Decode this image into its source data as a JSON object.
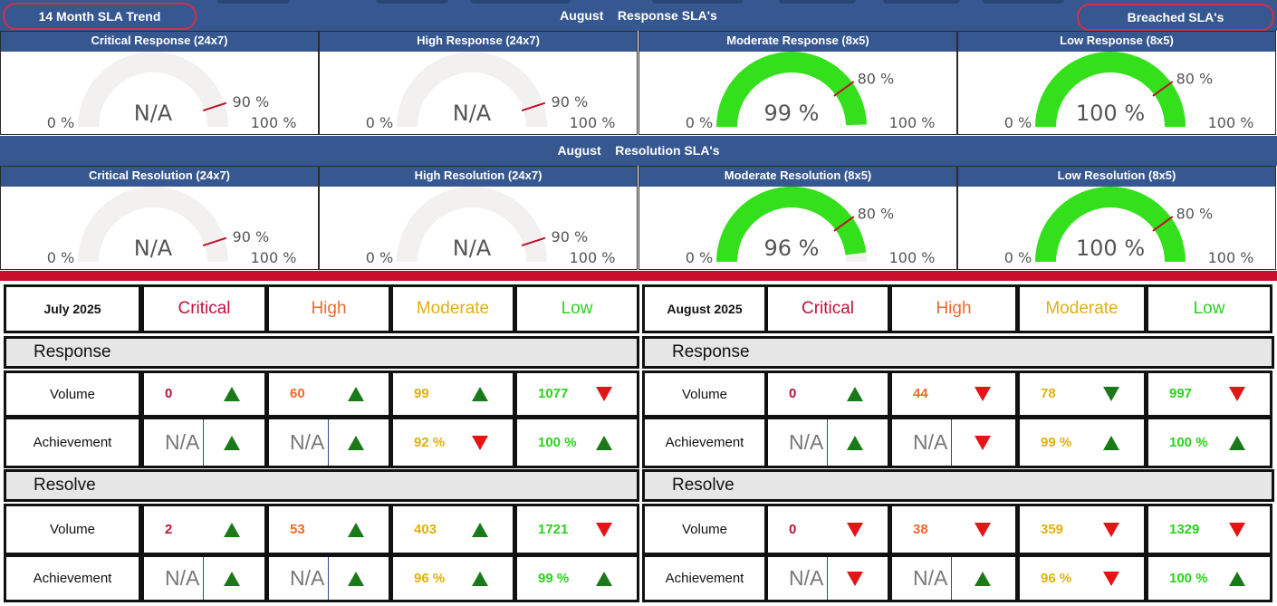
{
  "header": {
    "trend_button": "14 Month SLA Trend",
    "breached_button": "Breached SLA's",
    "response_title": "August    Response SLA's",
    "resolution_title": "August    Resolution SLA's"
  },
  "colors": {
    "band": "#36578f",
    "gauge_fill": "#33e01b",
    "gauge_empty": "#f2f1f0",
    "target": "#c0102b",
    "critical": "#c0103a",
    "high": "#ee6a2a",
    "moderate": "#e0b010",
    "low": "#2ad21c",
    "up": "#1a7a1a",
    "down": "#e61414"
  },
  "response_gauges": [
    {
      "title": "Critical Response (24x7)",
      "value_label": "N/A",
      "value": null,
      "target_label": "90 %",
      "target": 90,
      "min_label": "0 %",
      "max_label": "100 %"
    },
    {
      "title": "High Response (24x7)",
      "value_label": "N/A",
      "value": null,
      "target_label": "90 %",
      "target": 90,
      "min_label": "0 %",
      "max_label": "100 %"
    },
    {
      "title": "Moderate Response (8x5)",
      "value_label": "99 %",
      "value": 99,
      "target_label": "80 %",
      "target": 80,
      "min_label": "0 %",
      "max_label": "100 %"
    },
    {
      "title": "Low Response (8x5)",
      "value_label": "100 %",
      "value": 100,
      "target_label": "80 %",
      "target": 80,
      "min_label": "0 %",
      "max_label": "100 %"
    }
  ],
  "resolution_gauges": [
    {
      "title": "Critical Resolution (24x7)",
      "value_label": "N/A",
      "value": null,
      "target_label": "90 %",
      "target": 90,
      "min_label": "0 %",
      "max_label": "100 %"
    },
    {
      "title": "High Resolution (24x7)",
      "value_label": "N/A",
      "value": null,
      "target_label": "90 %",
      "target": 90,
      "min_label": "0 %",
      "max_label": "100 %"
    },
    {
      "title": "Moderate Resolution (8x5)",
      "value_label": "96 %",
      "value": 96,
      "target_label": "80 %",
      "target": 80,
      "min_label": "0 %",
      "max_label": "100 %"
    },
    {
      "title": "Low Resolution (8x5)",
      "value_label": "100 %",
      "value": 100,
      "target_label": "80 %",
      "target": 80,
      "min_label": "0 %",
      "max_label": "100 %"
    }
  ],
  "priorities": [
    "Critical",
    "High",
    "Moderate",
    "Low"
  ],
  "section_labels": {
    "response": "Response",
    "resolve": "Resolve"
  },
  "row_labels": {
    "volume": "Volume",
    "achievement": "Achievement"
  },
  "tables": [
    {
      "month": "July 2025",
      "response": {
        "volume": [
          {
            "v": "0",
            "t": "up"
          },
          {
            "v": "60",
            "t": "up"
          },
          {
            "v": "99",
            "t": "up"
          },
          {
            "v": "1077",
            "t": "down"
          }
        ],
        "achievement": [
          {
            "v": "N/A",
            "t": "up"
          },
          {
            "v": "N/A",
            "t": "up"
          },
          {
            "v": "92 %",
            "t": "down"
          },
          {
            "v": "100 %",
            "t": "up"
          }
        ]
      },
      "resolve": {
        "volume": [
          {
            "v": "2",
            "t": "up"
          },
          {
            "v": "53",
            "t": "up"
          },
          {
            "v": "403",
            "t": "up"
          },
          {
            "v": "1721",
            "t": "down"
          }
        ],
        "achievement": [
          {
            "v": "N/A",
            "t": "up"
          },
          {
            "v": "N/A",
            "t": "up"
          },
          {
            "v": "96 %",
            "t": "up"
          },
          {
            "v": "99 %",
            "t": "up"
          }
        ]
      }
    },
    {
      "month": "August 2025",
      "response": {
        "volume": [
          {
            "v": "0",
            "t": "up"
          },
          {
            "v": "44",
            "t": "down"
          },
          {
            "v": "78",
            "t": "down-green"
          },
          {
            "v": "997",
            "t": "down"
          }
        ],
        "achievement": [
          {
            "v": "N/A",
            "t": "up"
          },
          {
            "v": "N/A",
            "t": "down"
          },
          {
            "v": "99 %",
            "t": "up"
          },
          {
            "v": "100 %",
            "t": "up"
          }
        ]
      },
      "resolve": {
        "volume": [
          {
            "v": "0",
            "t": "down"
          },
          {
            "v": "38",
            "t": "down"
          },
          {
            "v": "359",
            "t": "down"
          },
          {
            "v": "1329",
            "t": "down"
          }
        ],
        "achievement": [
          {
            "v": "N/A",
            "t": "down"
          },
          {
            "v": "N/A",
            "t": "up"
          },
          {
            "v": "96 %",
            "t": "down"
          },
          {
            "v": "100 %",
            "t": "up"
          }
        ]
      }
    }
  ]
}
